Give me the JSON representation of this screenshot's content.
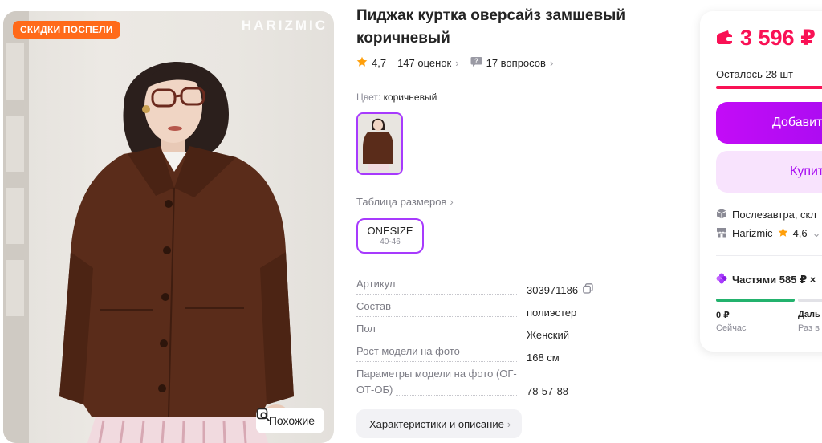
{
  "gallery": {
    "badge": "СКИДКИ ПОСПЕЛИ",
    "brand_watermark": "HARIZMIC",
    "similar_button": "Похожие"
  },
  "product": {
    "title": "Пиджак куртка оверсайз замшевый коричневый",
    "rating": "4,7",
    "reviews": "147 оценок",
    "questions": "17 вопросов",
    "color_label": "Цвет:",
    "color_value": "коричневый",
    "size_table_link": "Таблица размеров",
    "size": {
      "label": "ONESIZE",
      "range": "40-46"
    },
    "specs": [
      {
        "key": "Артикул",
        "value": "303971186"
      },
      {
        "key": "Состав",
        "value": "полиэстер"
      },
      {
        "key": "Пол",
        "value": "Женский"
      },
      {
        "key": "Рост модели на фото",
        "value": "168 см"
      },
      {
        "key": "Параметры модели на фото (ОГ-ОТ-ОБ)",
        "value": "78-57-88"
      }
    ],
    "characteristics_button": "Характеристики и описание"
  },
  "buy_card": {
    "price": "3 596 ₽",
    "stock": "Осталось 28 шт",
    "add_to_cart": "Добавит",
    "buy_now": "Купит",
    "delivery": "Послезавтра, скл",
    "seller_name": "Harizmic",
    "seller_rating": "4,6",
    "installments": "Частями 585 ₽ ×",
    "payment_now_amount": "0 ₽",
    "payment_now_label": "Сейчас",
    "payment_next_amount": "Даль",
    "payment_next_label": "Раз в"
  },
  "colors": {
    "accent_purple": "#a73afd",
    "price_red": "#f91155",
    "sale_orange": "#ff6a1a",
    "green": "#23b26d",
    "star": "#ff9f0a"
  }
}
